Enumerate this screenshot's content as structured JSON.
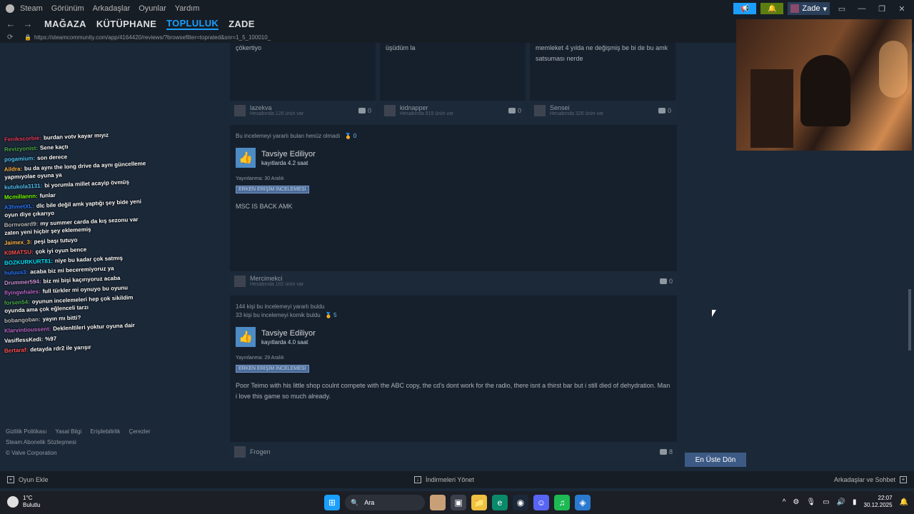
{
  "topmenu": [
    "Steam",
    "Görünüm",
    "Arkadaşlar",
    "Oyunlar",
    "Yardım"
  ],
  "user": {
    "name": "Zade"
  },
  "nav": {
    "tabs": [
      {
        "label": "MAĞAZA",
        "active": false
      },
      {
        "label": "KÜTÜPHANE",
        "active": false
      },
      {
        "label": "TOPLULUK",
        "active": true
      },
      {
        "label": "ZADE",
        "active": false
      }
    ],
    "url": "https://steamcommunity.com/app/4164420/reviews/?browsefilter=toprated&snr=1_5_100010_"
  },
  "chat": [
    {
      "user": "Fenikscorbie",
      "color": "#e04060",
      "text": "burdan votv kayar mıyız"
    },
    {
      "user": "Revizyonist",
      "color": "#4caf50",
      "text": "Sene kaçtı"
    },
    {
      "user": "pogamium",
      "color": "#4fc3f7",
      "text": "son derece"
    },
    {
      "user": "Aildra",
      "color": "#ffb74d",
      "text": "bu da aynı the long drive da aynı güncelleme yapmıyolae oyuna ya"
    },
    {
      "user": "kutukola3131",
      "color": "#4fc3f7",
      "text": "bi yorumla millet acayip övmüş"
    },
    {
      "user": "Mcmillannn",
      "color": "#76ff03",
      "text": "funlar"
    },
    {
      "user": "A3hmetXL",
      "color": "#2979ff",
      "text": "dlc bile değil amk yaptığı şey bide yeni oyun diye çıkarıyo"
    },
    {
      "user": "Bornvoard9",
      "color": "#bdbdbd",
      "text": "my summer carda da kış sezonu var zaten yeni hiçbir şey eklememiş"
    },
    {
      "user": "Jaimex_3",
      "color": "#ffb74d",
      "text": "peşi başı tutuyo"
    },
    {
      "user": "K0MATSU",
      "color": "#ff5252",
      "text": "çok iyi oyun bence"
    },
    {
      "user": "BOZKURKURT81",
      "color": "#00e5ff",
      "text": "niye bu kadar çok satmış"
    },
    {
      "user": "huluus3",
      "color": "#2979ff",
      "text": "acaba biz mi beceremiyoruz ya"
    },
    {
      "user": "Drummer594",
      "color": "#ce93d8",
      "text": "biz mi bişi kaçırıyoruz acaba"
    },
    {
      "user": "flyingwhales",
      "color": "#ba68c8",
      "text": "full türkler mi oynuyo bu oyunu"
    },
    {
      "user": "forsen54",
      "color": "#4caf50",
      "text": "oyunun incelemeleri hep çok sikildim oyunda ama çok eğlenceli tarzı"
    },
    {
      "user": "bobangoban",
      "color": "#bdbdbd",
      "text": "yayın mı bitti?"
    },
    {
      "user": "Klarvintioussent",
      "color": "#ba68c8",
      "text": "Deklenltileri yoktur oyuna dair"
    },
    {
      "user": "VasiflessKedi",
      "color": "#fff",
      "text": "%97"
    },
    {
      "user": "Bertaraf",
      "color": "#ff5252",
      "text": "detayda rdr2 ile yarışır"
    }
  ],
  "footer_links": [
    "Gizlilik Politikası",
    "Yasal Bilgi",
    "Erişilebilirlik",
    "Çerezler",
    "Steam Abonelik Sözleşmesi",
    "© Valve Corporation"
  ],
  "mini_reviews": [
    {
      "text": "çökertiyo",
      "user": "lazekva",
      "count": "Hesabında 126 ürün var",
      "comments": "0"
    },
    {
      "text": "üşüdüm la",
      "user": "kidnapper",
      "count": "Hesabında 815 ürün var",
      "comments": "0"
    },
    {
      "text": "memleket 4 yılda ne değişmiş be bi de bu amk satsuması nerde",
      "user": "Sensei",
      "count": "Hesabında 326 ürün var",
      "comments": "0"
    }
  ],
  "reviews": [
    {
      "helpful": "Bu incelemeyi yararlı bulan henüz olmadı",
      "funny_line": "",
      "award": "0",
      "recommend": "Tavsiye Ediliyor",
      "hours": "kayıtlarda 4.2 saat",
      "posted": "Yayınlanma: 30 Aralık",
      "badge": "ERKEN ERİŞİM İNCELEMESİ",
      "body": "MSC IS BACK AMK",
      "user": "Mercimekci",
      "count": "Hesabında 102 ürün var",
      "comments": "0"
    },
    {
      "helpful": "144 kişi bu incelemeyi yararlı buldu",
      "funny_line": "33 kişi bu incelemeyi komik buldu",
      "award": "5",
      "recommend": "Tavsiye Ediliyor",
      "hours": "kayıtlarda 4.0 saat",
      "posted": "Yayınlanma: 29 Aralık",
      "badge": "ERKEN ERİŞİM İNCELEMESİ",
      "body": "Poor Teimo with his little shop coulnt compete with the ABC copy, the cd's dont work for the radio, there isnt a thirst bar but i still died of dehydration. Man i love this game so much already.",
      "user": "Frogen",
      "count": "",
      "comments": "8"
    }
  ],
  "to_top": "En Üste Dön",
  "status": {
    "add_game": "Oyun Ekle",
    "downloads": "İndirmeleri Yönet",
    "friends": "Arkadaşlar ve Sohbet"
  },
  "taskbar": {
    "temp": "1°C",
    "weather": "Bulutlu",
    "search": "Ara",
    "time": "22:07",
    "date": "30.12.2025"
  }
}
